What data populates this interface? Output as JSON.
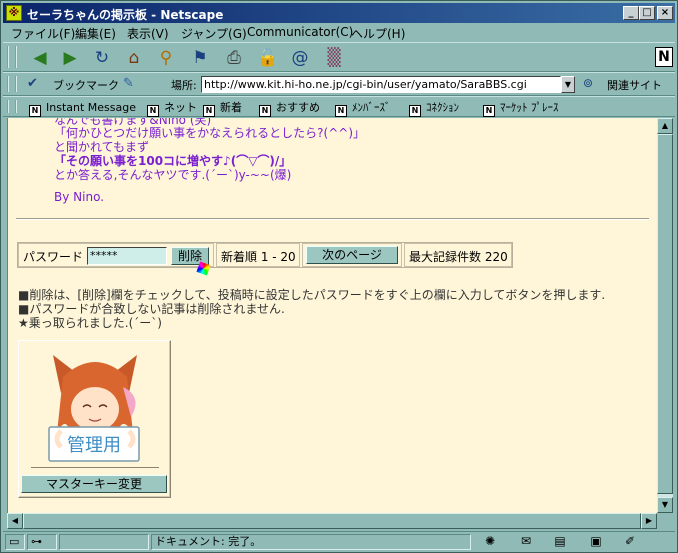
{
  "window": {
    "title": "セーラちゃんの掲示板 - Netscape"
  },
  "menu": [
    "ファイル(F)",
    "編集(E)",
    "表示(V)",
    "ジャンプ(G)",
    "Communicator(C)",
    "ヘルプ(H)"
  ],
  "location": {
    "bookmark_label": "ブックマーク",
    "label": "場所:",
    "url": "http://www.kit.hi-ho.ne.jp/cgi-bin/user/yamato/SaraBBS.cgi",
    "related_label": "関連サイト"
  },
  "personal_bar": [
    "Instant Message",
    "ネット",
    "新着",
    "おすすめ",
    "ﾒﾝﾊﾞｰｽﾞ",
    "ｺﾈｸｼｮﾝ",
    "ﾏｰｹｯﾄ ﾌﾟﾚｰｽ"
  ],
  "post": {
    "line0": "なんでも書けます&Nino  (笑)",
    "line1": "「何かひとつだけ願い事をかなえられるとしたら?(^^)」",
    "line2": "と聞かれてもまず",
    "line3": "「その願い事を100コに増やす♪(⌒▽⌒)/」",
    "line4": "とか答える,そんなヤツです.(´ー`)y-~~(爆)",
    "signature": "By Nino."
  },
  "controls": {
    "password_label": "パスワード",
    "password_value": "*****",
    "delete_button": "削除",
    "range_text": "新着順 1 - 20",
    "next_page_button": "次のページ",
    "max_records": "最大記録件数 220"
  },
  "notes": {
    "line1": "■削除は、[削除]欄をチェックして、投稿時に設定したパスワードをすぐ上の欄に入力してボタンを押します.",
    "line2": "■パスワードが合致しない記事は削除されません.",
    "line3": "★乗っ取られました.(´ー`)"
  },
  "admin": {
    "image_caption": "管理用",
    "master_key_button": "マスターキー変更"
  },
  "status": {
    "text": "ドキュメント: 完了。"
  }
}
